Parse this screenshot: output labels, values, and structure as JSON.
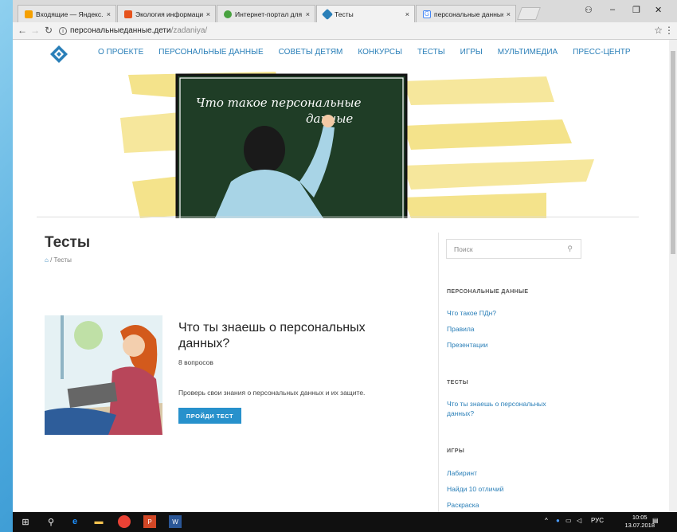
{
  "browser": {
    "tabs": [
      {
        "title": "Входящие — Яндекс.По",
        "fav_color": "#f5a000",
        "active": false
      },
      {
        "title": "Экология информацион",
        "fav_color": "#e6531d",
        "active": false
      },
      {
        "title": "Интернет-портал для по",
        "fav_color": "#48a23f",
        "active": false
      },
      {
        "title": "Тесты",
        "fav_color": "#2a7fb8",
        "active": true
      },
      {
        "title": "персональные данные",
        "fav_color": "#4285f4",
        "active": false
      }
    ],
    "tab_close": "×",
    "url_domain": "персональныеданные.дети",
    "url_path": "/zadaniya/"
  },
  "site": {
    "menu": [
      "О ПРОЕКТЕ",
      "ПЕРСОНАЛЬНЫЕ ДАННЫЕ",
      "СОВЕТЫ ДЕТЯМ",
      "КОНКУРСЫ",
      "ТЕСТЫ",
      "ИГРЫ",
      "МУЛЬТИМЕДИА",
      "ПРЕСС-ЦЕНТР"
    ],
    "hero_caption": [
      "Что такое персональные",
      "данные"
    ],
    "page_title": "Тесты",
    "breadcrumb_current": "/ Тесты",
    "brand_color": "#2791cc"
  },
  "test_card": {
    "title": "Что ты знаешь о персональных данных?",
    "count": "8 вопросов",
    "description": "Проверь свои знания о персональных данных и их защите.",
    "button": "ПРОЙДИ ТЕСТ"
  },
  "sidebar": {
    "search_placeholder": "Поиск",
    "sections": [
      {
        "heading": "ПЕРСОНАЛЬНЫЕ ДАННЫЕ",
        "links": [
          "Что такое ПДн?",
          "Правила",
          "Презентации"
        ]
      },
      {
        "heading": "ТЕСТЫ",
        "links": [
          "Что ты знаешь о персональных данных?"
        ]
      },
      {
        "heading": "ИГРЫ",
        "links": [
          "Лабиринт",
          "Найди 10 отличий",
          "Раскраска"
        ]
      }
    ]
  },
  "taskbar": {
    "lang": "РУС",
    "time": "10:05",
    "date": "13.07.2018"
  }
}
